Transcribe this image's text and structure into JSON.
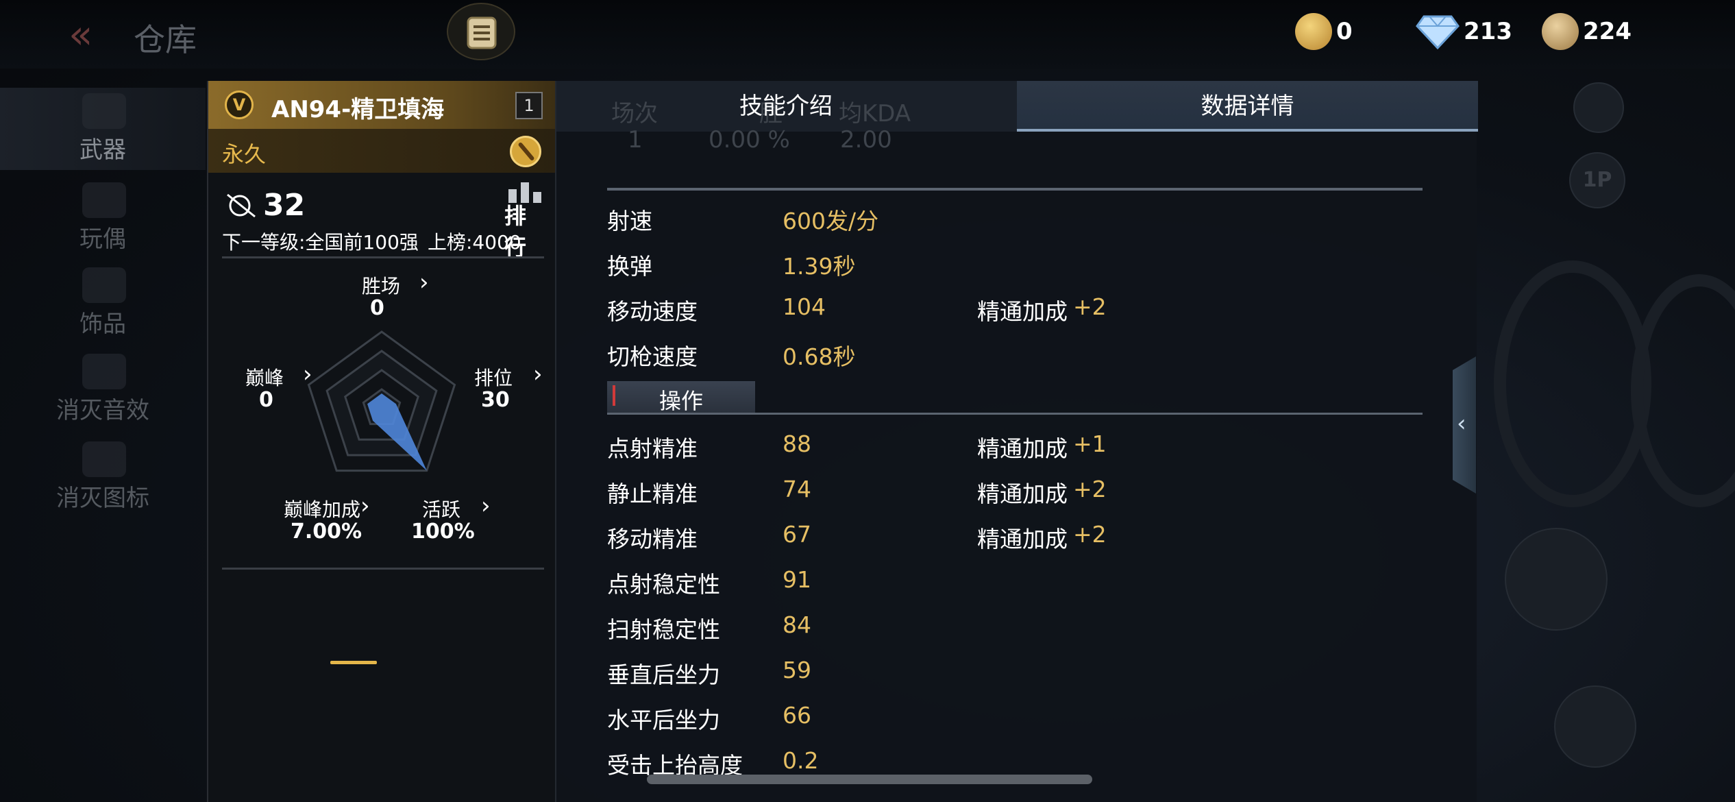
{
  "topbar": {
    "title": "仓库",
    "currencies": [
      {
        "icon": "gold-ticket-coin-icon",
        "value": "0",
        "color": "#d9a94a"
      },
      {
        "icon": "diamond-icon",
        "value": "213",
        "color": "#9cc8f0"
      },
      {
        "icon": "crossed-swords-coin-icon",
        "value": "224",
        "color": "#c9a36a"
      }
    ]
  },
  "leftnav": {
    "items": [
      {
        "label": "武器",
        "icon": "rifle-icon",
        "active": true
      },
      {
        "label": "玩偶",
        "icon": "doll-icon"
      },
      {
        "label": "饰品",
        "icon": "ornament-icon"
      },
      {
        "label": "消灭音效",
        "icon": "sound-icon"
      },
      {
        "label": "消灭图标",
        "icon": "emblem-icon"
      }
    ]
  },
  "card": {
    "badge": "V",
    "weapon_name": "AN94-精卫填海",
    "count": "1",
    "duration": "永久",
    "stat_value": "32",
    "rank_label": "排行",
    "next_level": "下一等级:全国前100强",
    "rank_entry": "上榜:4000",
    "radar": {
      "axes": [
        {
          "label": "胜场",
          "value": "0",
          "level": 0.0
        },
        {
          "label": "排位",
          "value": "30",
          "level": 0.12
        },
        {
          "label": "活跃",
          "value": "100%",
          "level": 1.0
        },
        {
          "label": "巅峰加成",
          "value": "7.00%",
          "level": 0.08
        },
        {
          "label": "巅峰",
          "value": "0",
          "level": 0.1
        }
      ],
      "color": "#4f86d9"
    }
  },
  "panel": {
    "tabs": [
      {
        "label": "技能介绍",
        "active": false
      },
      {
        "label": "数据详情",
        "active": true
      }
    ],
    "ghost": [
      "场次",
      "胜",
      "均KDA",
      "1",
      "0.00 %",
      "2.00"
    ],
    "stats_top": [
      {
        "name": "射速",
        "value": "600发/分"
      },
      {
        "name": "换弹",
        "value": "1.39秒"
      },
      {
        "name": "移动速度",
        "value": "104",
        "bonus_label": "精通加成",
        "bonus": "+2"
      },
      {
        "name": "切枪速度",
        "value": "0.68秒"
      }
    ],
    "section": "操作",
    "stats_ops": [
      {
        "name": "点射精准",
        "value": "88",
        "bonus_label": "精通加成",
        "bonus": "+1"
      },
      {
        "name": "静止精准",
        "value": "74",
        "bonus_label": "精通加成",
        "bonus": "+2"
      },
      {
        "name": "移动精准",
        "value": "67",
        "bonus_label": "精通加成",
        "bonus": "+2"
      },
      {
        "name": "点射稳定性",
        "value": "91"
      },
      {
        "name": "扫射稳定性",
        "value": "84"
      },
      {
        "name": "垂直后坐力",
        "value": "59"
      },
      {
        "name": "水平后坐力",
        "value": "66"
      },
      {
        "name": "受击上抬高度",
        "value": "0.2"
      }
    ]
  },
  "hud": {
    "perspective_label": "1P"
  }
}
